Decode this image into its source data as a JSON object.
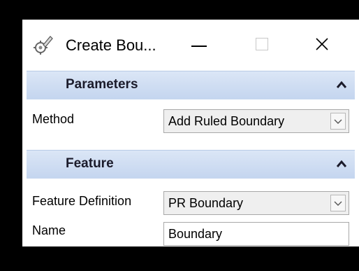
{
  "window": {
    "title": "Create Bou...",
    "icon": "gear-pencil-icon"
  },
  "parameters": {
    "header": "Parameters",
    "method_label": "Method",
    "method_value": "Add Ruled Boundary"
  },
  "feature": {
    "header": "Feature",
    "definition_label": "Feature Definition",
    "definition_value": "PR Boundary",
    "name_label": "Name",
    "name_value": "Boundary"
  },
  "colors": {
    "section_header": "#c4d5ef",
    "background": "#000000"
  }
}
